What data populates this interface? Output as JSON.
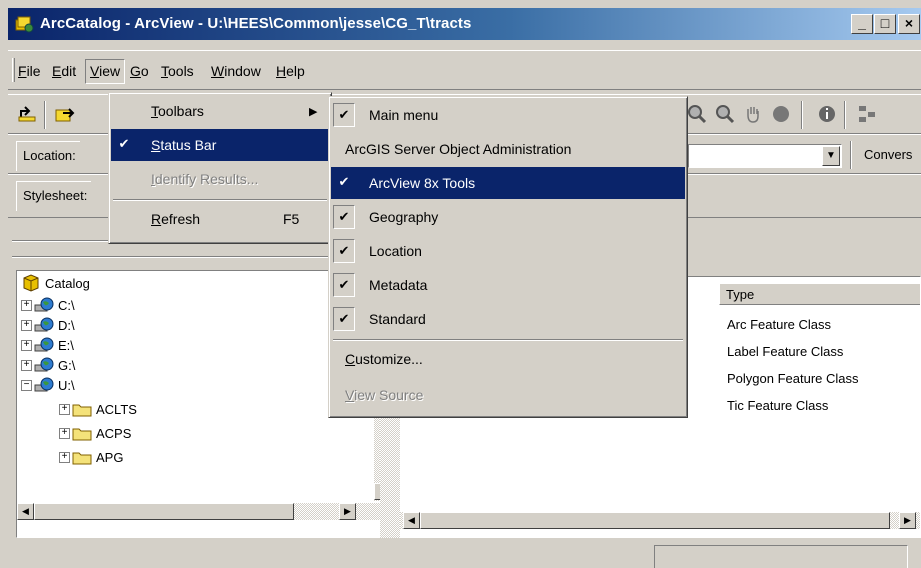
{
  "window": {
    "title": "ArcCatalog - ArcView - U:\\HEES\\Common\\jesse\\CG_T\\tracts",
    "minimize_glyph": "_",
    "maximize_glyph": "□",
    "close_glyph": "×"
  },
  "menubar": {
    "items": [
      {
        "label": "File",
        "u": "F",
        "rest": "ile"
      },
      {
        "label": "Edit",
        "u": "E",
        "rest": "dit"
      },
      {
        "label": "View",
        "u": "V",
        "rest": "iew"
      },
      {
        "label": "Go",
        "u": "G",
        "rest": "o"
      },
      {
        "label": "Tools",
        "u": "T",
        "rest": "ools"
      },
      {
        "label": "Window",
        "u": "W",
        "rest": "indow"
      },
      {
        "label": "Help",
        "u": "H",
        "rest": "elp"
      }
    ]
  },
  "toolbar": {
    "location_label": "Location:",
    "stylesheet_label": "Stylesheet:",
    "conversion_label": "Convers"
  },
  "view_menu": {
    "items": [
      {
        "u": "T",
        "rest": "oolbars",
        "has_submenu": true
      },
      {
        "u": "S",
        "rest": "tatus Bar",
        "checked": true,
        "highlighted": true
      },
      {
        "u": "I",
        "rest": "dentify Results...",
        "disabled": true
      },
      {
        "u": "R",
        "rest": "efresh",
        "shortcut": "F5"
      }
    ]
  },
  "toolbars_submenu": {
    "items": [
      {
        "label": "Main menu",
        "checked": true
      },
      {
        "label": "ArcGIS Server Object Administration",
        "checked": false
      },
      {
        "label": "ArcView 8x Tools",
        "checked": true,
        "highlighted": true
      },
      {
        "label": "Geography",
        "checked": true
      },
      {
        "label": "Location",
        "checked": true
      },
      {
        "label": "Metadata",
        "checked": true
      },
      {
        "label": "Standard",
        "checked": true
      },
      {
        "u": "C",
        "rest": "ustomize..."
      },
      {
        "u": "V",
        "rest": "iew Source",
        "disabled": true
      }
    ],
    "checkmark": "✔"
  },
  "tree": {
    "root": "Catalog",
    "drives": [
      "C:\\",
      "D:\\",
      "E:\\",
      "G:\\",
      "U:\\"
    ],
    "folders": [
      "ACLTS",
      "ACPS",
      "APG"
    ]
  },
  "list": {
    "column_type": "Type",
    "rows": [
      "Arc Feature Class",
      "Label Feature Class",
      "Polygon Feature Class",
      "Tic Feature Class"
    ]
  },
  "colors": {
    "titlebar_start": "#0a246a",
    "titlebar_end": "#a6caf0",
    "highlight": "#0a246a",
    "face": "#d4d0c8"
  }
}
